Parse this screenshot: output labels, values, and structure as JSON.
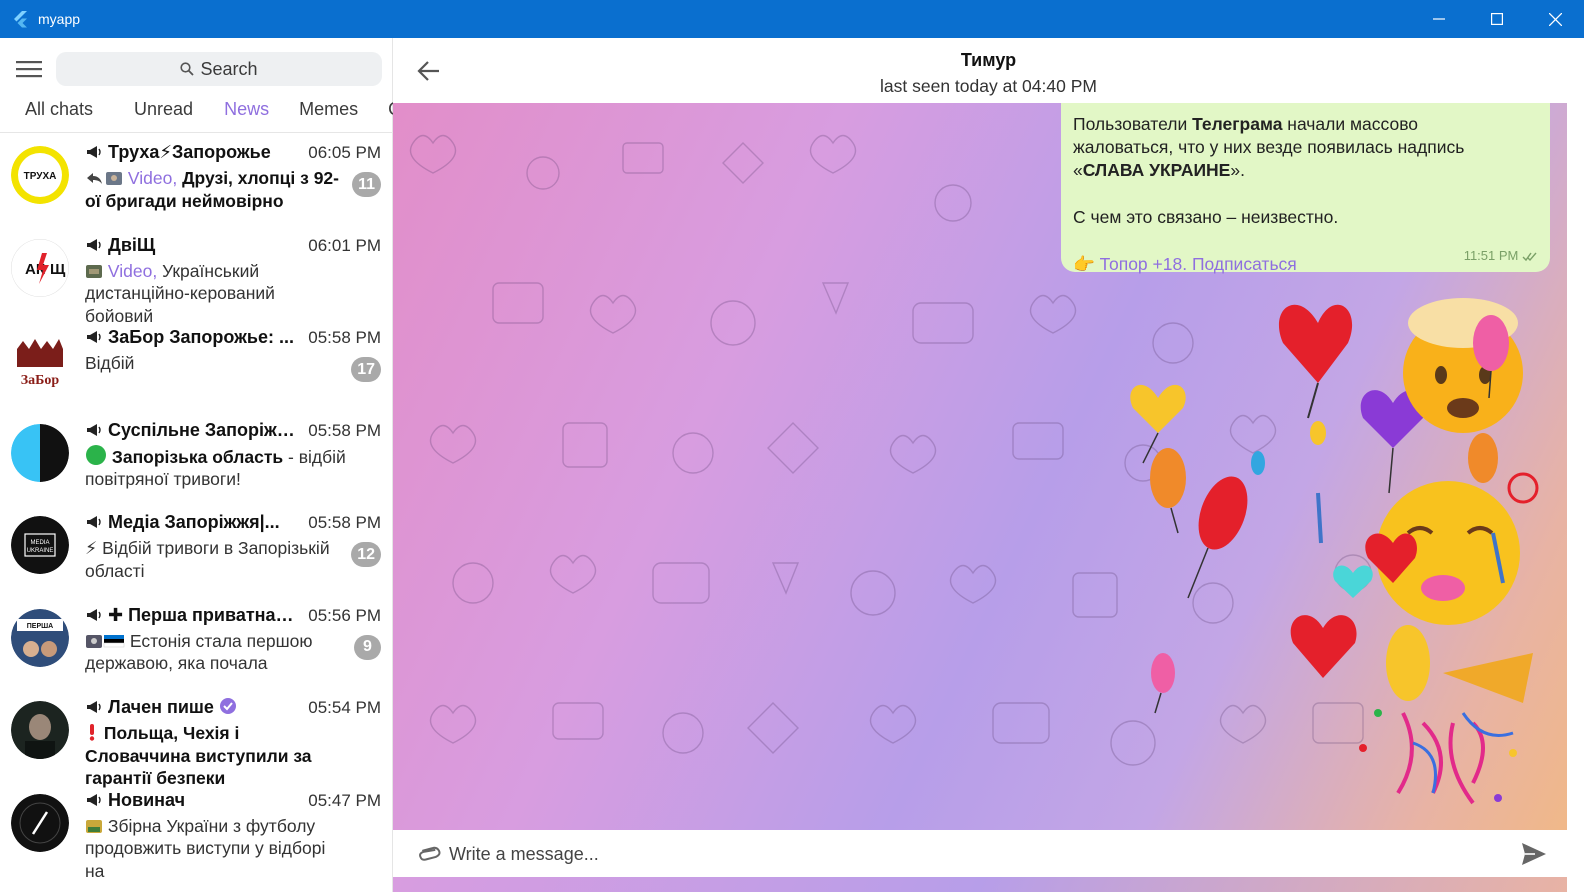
{
  "window": {
    "title": "myapp"
  },
  "sidebar": {
    "search_placeholder": "Search",
    "tabs": [
      "All chats",
      "Unread",
      "News",
      "Memes",
      "G"
    ],
    "active_tab": "News",
    "chats": [
      {
        "name": "Труха⚡Запорожье",
        "time": "06:05 PM",
        "preview_media": "Video,",
        "preview_text": "Друзі, хлопці з 92-ої бригади неймовірно",
        "unread": "11"
      },
      {
        "name": "ДвіЩ",
        "time": "06:01 PM",
        "preview_media": "Video,",
        "preview_text": "Український дистанційно-керований бойовий",
        "unread": ""
      },
      {
        "name": "ЗаБор Запорожье: ...",
        "time": "05:58 PM",
        "preview_text": "Відбій",
        "unread": "17"
      },
      {
        "name": "Суспільне Запоріжж...",
        "time": "05:58 PM",
        "preview_bold": "Запорізька область",
        "preview_text": "- відбій повітряної тривоги!",
        "unread": ""
      },
      {
        "name": "Медіа Запоріжжя|...",
        "time": "05:58 PM",
        "preview_text": "⚡ Відбій тривоги в Запорізькій області",
        "unread": "12"
      },
      {
        "name": "✚ Перша приватна ...",
        "time": "05:56 PM",
        "preview_text": "Естонія стала першою державою, яка почала",
        "unread": "9"
      },
      {
        "name": "Лачен пише",
        "time": "05:54 PM",
        "preview_bold": "Польща, Чехія і Словаччина виступили за гарантії безпеки",
        "unread": ""
      },
      {
        "name": "Новинач",
        "time": "05:47 PM",
        "preview_text": "Збірна України з футболу продовжить виступи у відборі на",
        "unread": ""
      }
    ]
  },
  "chat": {
    "peer_name": "Тимур",
    "peer_status": "last seen today at 04:40 PM",
    "message": {
      "line1_pre": "Пользователи ",
      "line1_bold": "Телеграма",
      "line1_post": " начали массово",
      "line2": "жаловаться, что у них везде появилась надпись",
      "line3_open": "«",
      "line3_bold": "СЛАВА УКРАИНЕ",
      "line3_close": "».",
      "line4": "С чем это связано – неизвестно.",
      "link_emoji": "👉",
      "link_text": "Топор +18. Подписаться",
      "time": "11:51 PM"
    },
    "composer_placeholder": "Write a message..."
  },
  "colors": {
    "titlebar": "#0a6fcf",
    "accent": "#8f6fdf",
    "bubble": "#e2f7c6",
    "badge": "#a9a9a9"
  }
}
